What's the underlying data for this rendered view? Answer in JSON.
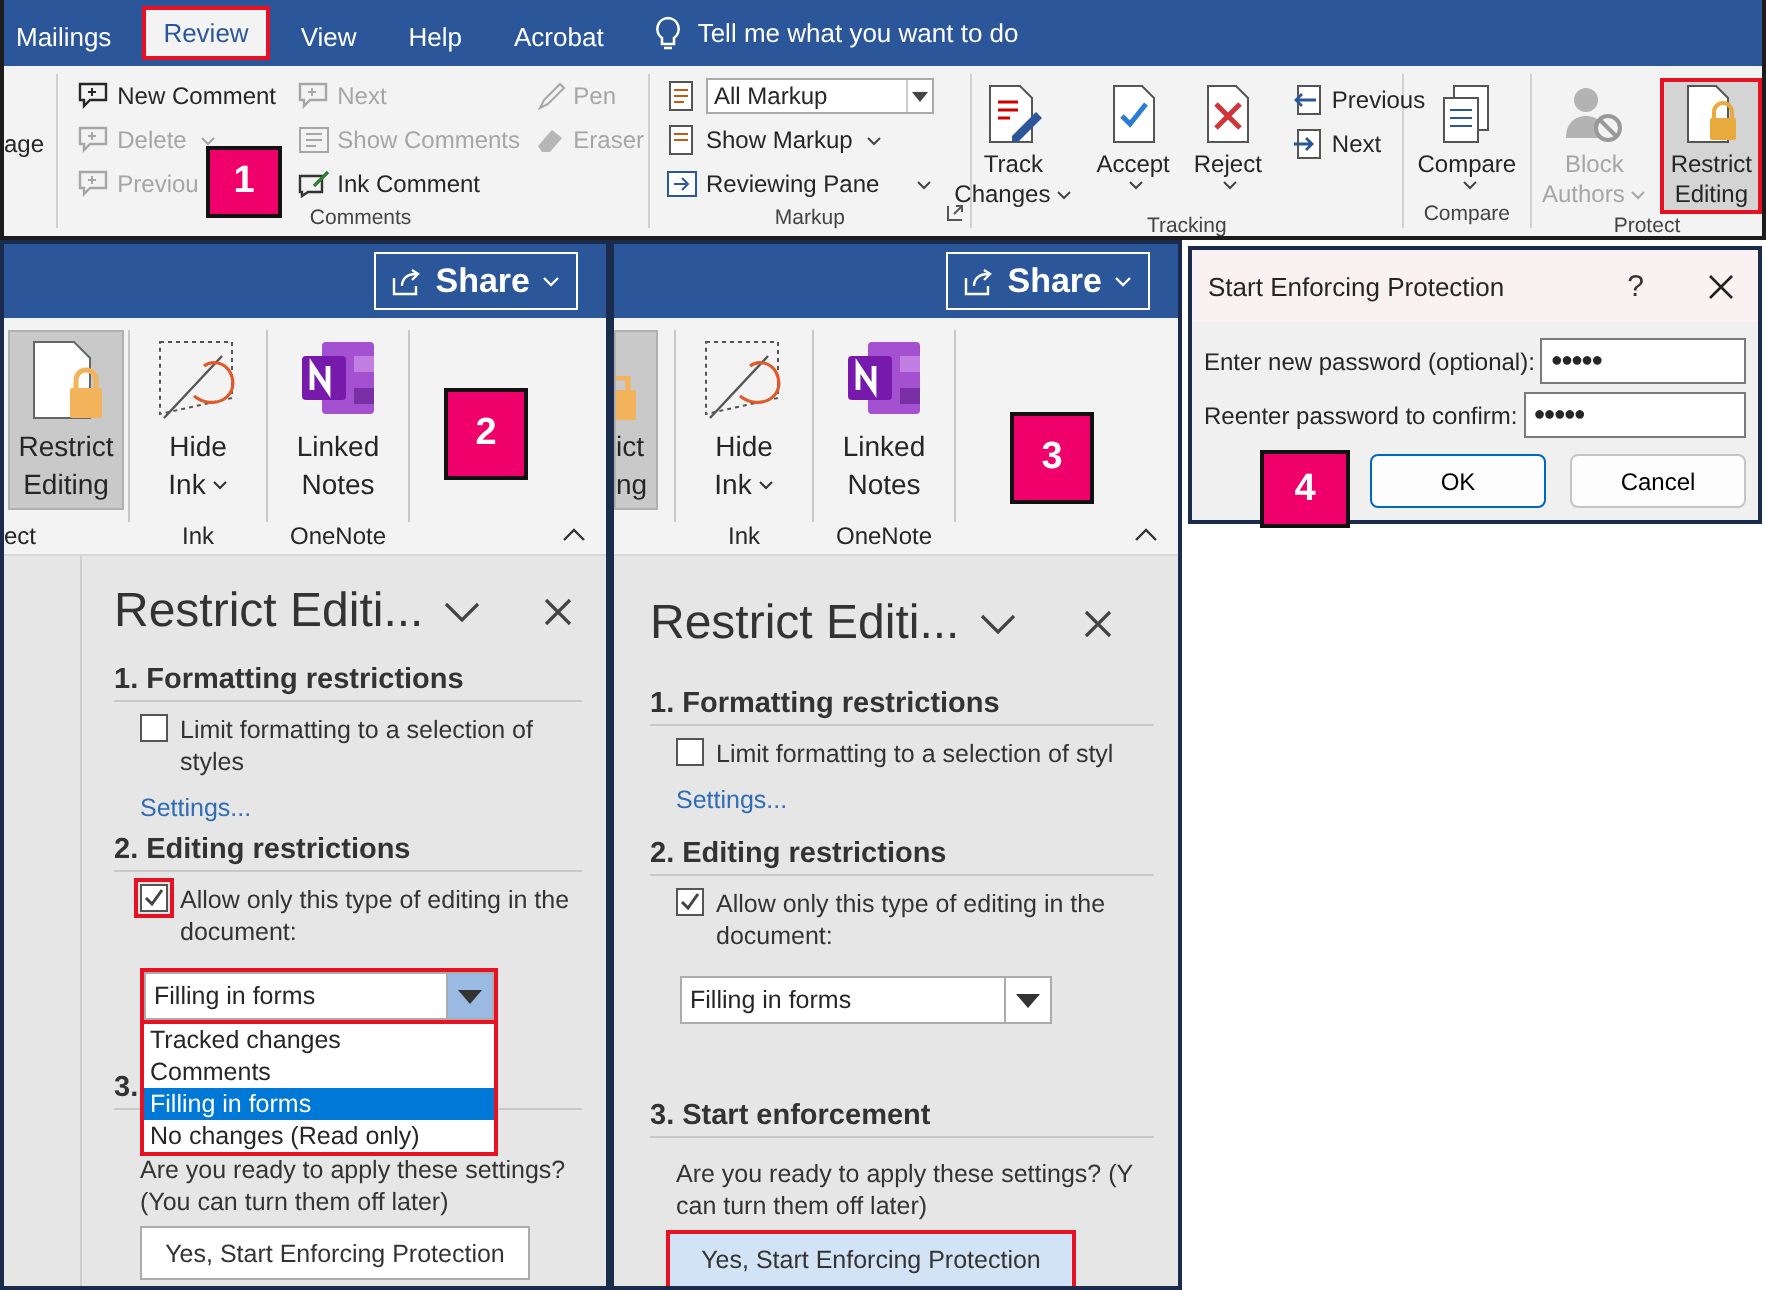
{
  "ribbon": {
    "tabs": [
      {
        "label": "Mailings",
        "selected": false,
        "highlighted": false
      },
      {
        "label": "Review",
        "selected": true,
        "highlighted": true
      },
      {
        "label": "View",
        "selected": false,
        "highlighted": false
      },
      {
        "label": "Help",
        "selected": false,
        "highlighted": false
      },
      {
        "label": "Acrobat",
        "selected": false,
        "highlighted": false
      }
    ],
    "tell_me": "Tell me what you want to do",
    "cut_group_label": "age",
    "callout": "1",
    "comments": {
      "label": "Comments",
      "buttons": [
        {
          "label": "New Comment",
          "disabled": false,
          "has_menu": false
        },
        {
          "label": "Delete",
          "disabled": true,
          "has_menu": true
        },
        {
          "label": "Previou",
          "disabled": true,
          "has_menu": false
        },
        {
          "label": "Next",
          "disabled": true,
          "has_menu": false
        },
        {
          "label": "Show Comments",
          "disabled": true,
          "has_menu": false
        },
        {
          "label": "Ink Comment",
          "disabled": false,
          "has_menu": false
        },
        {
          "label": "Pen",
          "disabled": true,
          "has_menu": false
        },
        {
          "label": "Eraser",
          "disabled": true,
          "has_menu": false
        }
      ]
    },
    "markup": {
      "label": "Markup",
      "display": "All Markup",
      "buttons": [
        {
          "label": "Show Markup",
          "has_menu": true
        },
        {
          "label": "Reviewing Pane",
          "has_menu": true
        }
      ]
    },
    "tracking": {
      "label": "Tracking",
      "large": [
        {
          "lines": [
            "Track",
            "Changes"
          ],
          "has_menu": true
        },
        {
          "lines": [
            "Accept"
          ],
          "has_menu": true
        },
        {
          "lines": [
            "Reject"
          ],
          "has_menu": true
        }
      ],
      "small": [
        {
          "label": "Previous"
        },
        {
          "label": "Next"
        }
      ]
    },
    "compare": {
      "label": "Compare",
      "large": [
        {
          "lines": [
            "Compare"
          ],
          "has_menu": true
        }
      ]
    },
    "protect": {
      "label": "Protect",
      "large": [
        {
          "lines": [
            "Block",
            "Authors"
          ],
          "has_menu": true,
          "disabled": true,
          "highlighted": false
        },
        {
          "lines": [
            "Restrict",
            "Editing"
          ],
          "has_menu": false,
          "disabled": false,
          "highlighted": true
        }
      ]
    }
  },
  "panels": [
    {
      "share": "Share",
      "callout": "2",
      "doc_margin_visible": true,
      "groups": [
        {
          "label": "ect",
          "button": {
            "lines": [
              "Restrict",
              "Editing"
            ],
            "has_menu": false,
            "pressed": true
          }
        },
        {
          "label": "Ink",
          "button": {
            "lines": [
              "Hide",
              "Ink"
            ],
            "has_menu": true,
            "pressed": false
          }
        },
        {
          "label": "OneNote",
          "button": {
            "lines": [
              "Linked",
              "Notes"
            ],
            "has_menu": false,
            "pressed": false
          }
        }
      ],
      "pane": {
        "title": "Restrict Editi...",
        "formatting": {
          "heading": "1. Formatting restrictions",
          "checkbox": "Limit formatting to a selection of styles",
          "checked": false,
          "link": "Settings..."
        },
        "editing": {
          "heading": "2. Editing restrictions",
          "checkbox": "Allow only this type of editing in the document:",
          "checked": true,
          "highlighted": true,
          "value": "Filling in forms",
          "open": true,
          "options": [
            {
              "label": "Tracked changes",
              "selected": false
            },
            {
              "label": "Comments",
              "selected": false
            },
            {
              "label": "Filling in forms",
              "selected": true
            },
            {
              "label": "No changes (Read only)",
              "selected": false
            }
          ]
        },
        "enforcement": {
          "heading": "3.",
          "lines": [
            "Are you ready to apply these settings?",
            "(You can turn them off later)"
          ],
          "button": "Yes, Start Enforcing Protection",
          "highlighted": false,
          "hovered": false
        }
      }
    },
    {
      "share": "Share",
      "callout": "3",
      "doc_margin_visible": false,
      "groups": [
        {
          "button": {
            "lines": [
              "ict",
              "ng"
            ],
            "has_menu": false,
            "pressed": true
          }
        },
        {
          "label": "Ink",
          "button": {
            "lines": [
              "Hide",
              "Ink"
            ],
            "has_menu": true,
            "pressed": false
          }
        },
        {
          "label": "OneNote",
          "button": {
            "lines": [
              "Linked",
              "Notes"
            ],
            "has_menu": false,
            "pressed": false
          }
        }
      ],
      "pane": {
        "title": "Restrict Editi...",
        "formatting": {
          "heading": "1. Formatting restrictions",
          "checkbox": "Limit formatting to a selection of styl",
          "checked": false,
          "link": "Settings..."
        },
        "editing": {
          "heading": "2. Editing restrictions",
          "checkbox": "Allow only this type of editing in the document:",
          "checked": true,
          "highlighted": false,
          "value": "Filling in forms",
          "open": false
        },
        "enforcement": {
          "heading": "3. Start enforcement",
          "lines": [
            "Are you ready to apply these settings? (Y",
            "can turn them off later)"
          ],
          "button": "Yes, Start Enforcing Protection",
          "highlighted": true,
          "hovered": true
        }
      }
    }
  ],
  "dialog": {
    "title": "Start Enforcing Protection",
    "help": "?",
    "callout": "4",
    "fields": [
      {
        "label": "Enter new password (optional):",
        "value": "●●●●●"
      },
      {
        "label": "Reenter password to confirm:",
        "value": "●●●●●"
      }
    ],
    "buttons": [
      {
        "label": "OK",
        "default": true
      },
      {
        "label": "Cancel",
        "default": false
      }
    ]
  }
}
